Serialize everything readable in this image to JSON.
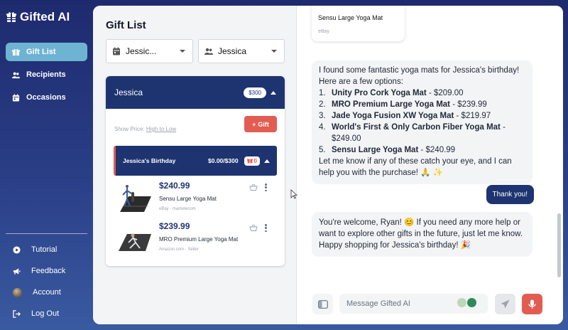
{
  "brand": {
    "name": "Gifted AI"
  },
  "sidebar": {
    "items": [
      {
        "label": "Gift List",
        "icon": "gift-icon",
        "active": true
      },
      {
        "label": "Recipients",
        "icon": "users-icon"
      },
      {
        "label": "Occasions",
        "icon": "calendar-icon"
      }
    ],
    "bottom_items": [
      {
        "label": "Tutorial",
        "icon": "play-icon"
      },
      {
        "label": "Feedback",
        "icon": "megaphone-icon"
      },
      {
        "label": "Account",
        "icon": "avatar"
      },
      {
        "label": "Log Out",
        "icon": "logout-icon"
      }
    ]
  },
  "gift_list": {
    "title": "Gift List",
    "filter_occasion": "Jessic...",
    "filter_recipient": "Jessica",
    "recipient": {
      "name": "Jessica",
      "budget": "$300"
    },
    "show_price_label": "Show Price:",
    "show_price_value": "High to Low",
    "gift_button": "Gift",
    "occasion": {
      "name": "Jessica's Birthday",
      "amount": "$0.00/$300",
      "count": "0"
    },
    "items": [
      {
        "price": "$240.99",
        "name": "Sensu Large Yoga Mat",
        "source": "eBay - mamelecom"
      },
      {
        "price": "$239.99",
        "name": "MRO Premium Large Yoga Mat",
        "source": "Amazon.com - Seller"
      }
    ]
  },
  "chat": {
    "product_card": {
      "name": "Sensu Large Yoga Mat",
      "source": "eBay"
    },
    "bot_message_1": {
      "intro": "I found some fantastic yoga mats for Jessica's birthday! Here are a few options:",
      "options": [
        {
          "num": "1.",
          "name": "Unity Pro Cork Yoga Mat",
          "price": " - $209.00"
        },
        {
          "num": "2.",
          "name": "MRO Premium Large Yoga Mat",
          "price": " - $239.99"
        },
        {
          "num": "3.",
          "name": "Jade Yoga Fusion XW Yoga Mat",
          "price": " - $219.97"
        },
        {
          "num": "4.",
          "name": "World's First & Only Carbon Fiber Yoga Mat",
          "price": " - $249.00"
        },
        {
          "num": "5.",
          "name": "Sensu Large Yoga Mat",
          "price": " - $240.99"
        }
      ],
      "outro": "Let me know if any of these catch your eye, and I can help you with the purchase! 🙏 ✨"
    },
    "user_message": "Thank you!",
    "bot_message_2": "You're welcome, Ryan! 😊 If you need any more help or want to explore other gifts in the future, just let me know. Happy shopping for Jessica's birthday! 🎉",
    "input_placeholder": "Message Gifted AI"
  },
  "colors": {
    "navy": "#1e3470",
    "accent_red": "#e25c52",
    "active_nav": "#6fb3d2"
  }
}
